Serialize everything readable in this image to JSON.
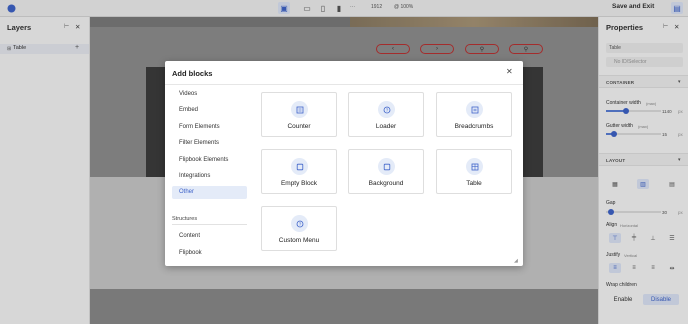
{
  "topbar": {
    "device_value": "1912",
    "zoom_value": "@ 100%",
    "save_exit_label": "Save and Exit",
    "more_label": "···"
  },
  "layers": {
    "title": "Layers",
    "row_label": "Table",
    "add_label": "+",
    "close_label": "✕"
  },
  "canvas": {
    "pills": [
      "‹",
      "›",
      "⚲",
      "⚲"
    ]
  },
  "properties": {
    "title": "Properties",
    "close_label": "✕",
    "name_value": "Table",
    "id_placeholder": "No ID/Selector",
    "container_section": "CONTAINER",
    "container_width_label": "Container width",
    "container_width_unit": "(max)",
    "container_width_value": "1140",
    "container_width_unit_short": "px",
    "gutter_width_label": "Gutter width",
    "gutter_width_unit": "(max)",
    "gutter_width_value": "15",
    "gutter_width_unit_short": "px",
    "layout_section": "LAYOUT",
    "gap_label": "Gap",
    "gap_value": "30",
    "gap_unit": "px",
    "align_label": "Align",
    "align_sub": "Horizontal",
    "justify_label": "Justify",
    "justify_sub": "Vertical",
    "wrap_label": "Wrap children",
    "enable_label": "Enable",
    "disable_label": "Disable",
    "accent": "#3e63c9"
  },
  "modal": {
    "title": "Add blocks",
    "close_label": "✕",
    "categories": [
      "Videos",
      "Embed",
      "Form Elements",
      "Filter Elements",
      "Flipbook Elements",
      "Integrations",
      "Other"
    ],
    "active_category": "Other",
    "structures_label": "Structures",
    "structures": [
      "Content",
      "Flipbook"
    ],
    "blocks": [
      {
        "label": "Counter",
        "icon": "counter-icon"
      },
      {
        "label": "Loader",
        "icon": "loader-icon"
      },
      {
        "label": "Breadcrumbs",
        "icon": "breadcrumbs-icon"
      },
      {
        "label": "Empty Block",
        "icon": "empty-block-icon"
      },
      {
        "label": "Background",
        "icon": "background-icon"
      },
      {
        "label": "Table",
        "icon": "table-icon"
      },
      {
        "label": "Custom Menu",
        "icon": "custom-menu-icon"
      }
    ]
  }
}
